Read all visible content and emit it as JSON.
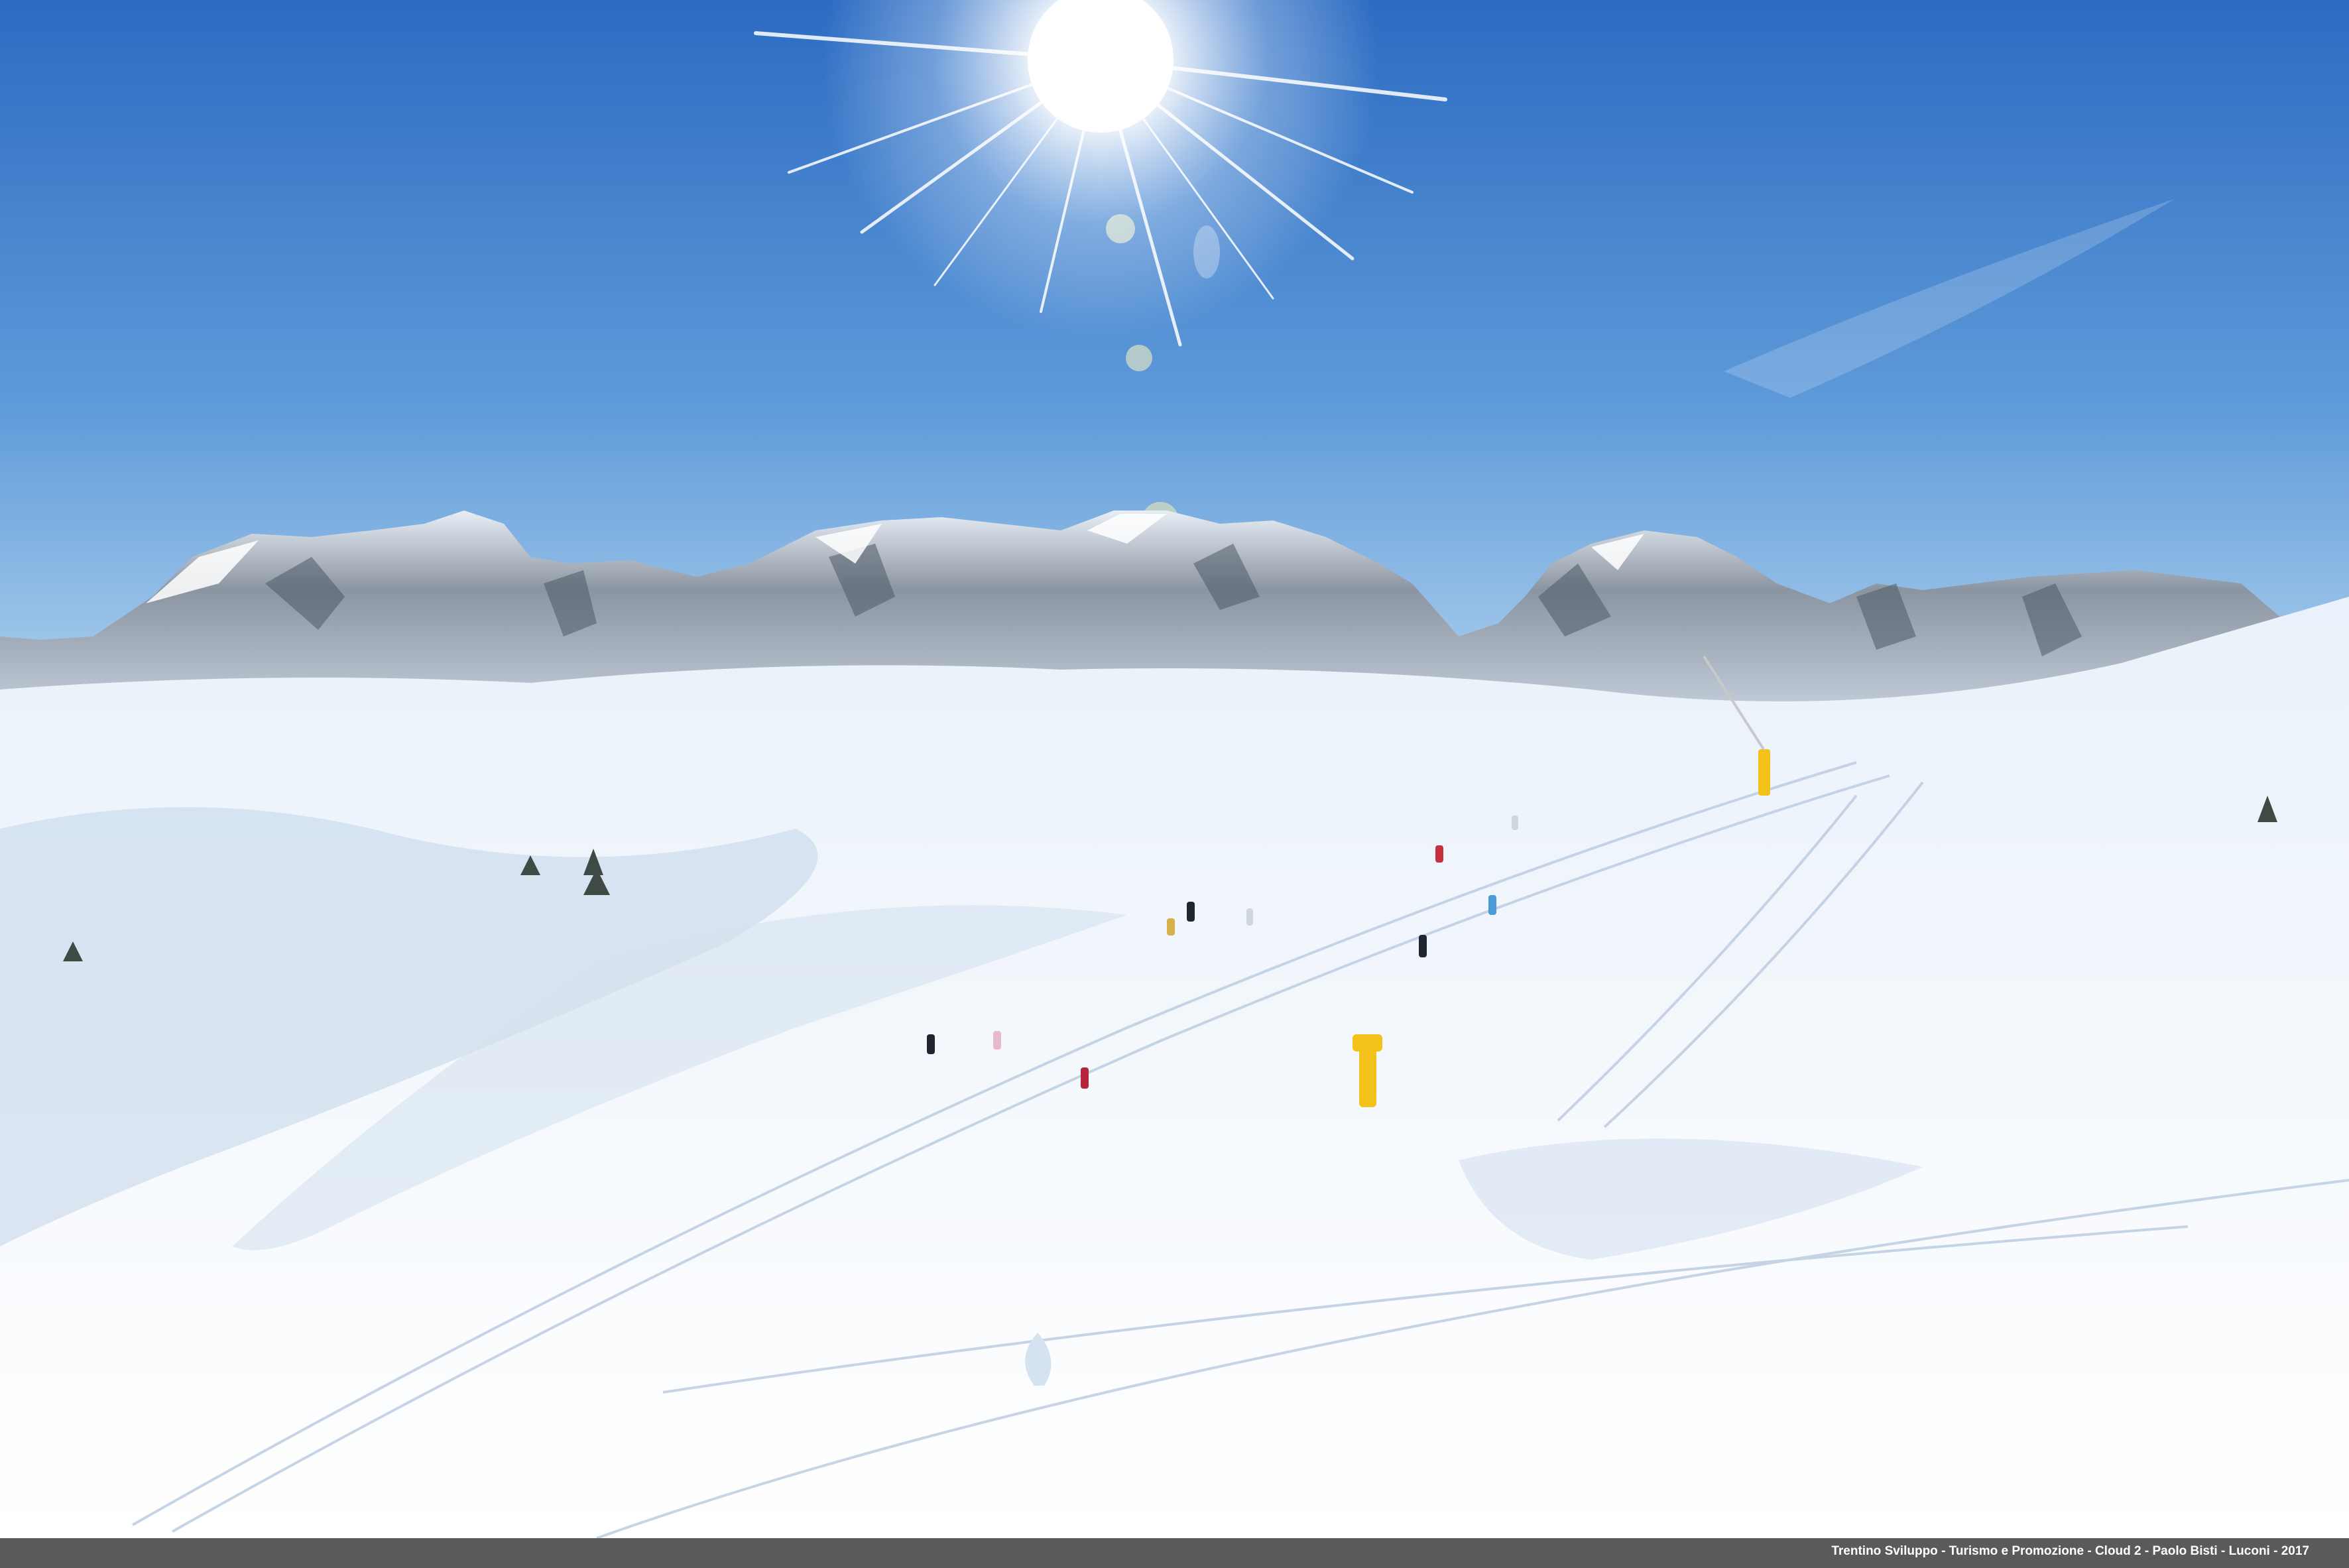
{
  "photo": {
    "subject": "ski-slope-with-dolomite-mountains",
    "credit": "Trentino Sviluppo - Turismo e Promozione - Cloud 2 - Paolo Bisti - Luconi - 2017",
    "colors": {
      "sky_top": "#2f6fc4",
      "sky_horizon": "#a9cfee",
      "snow": "#fbfdff",
      "snow_shadow": "#c9d8ea",
      "rock": "#6f7a86",
      "snow_cannon": "#f2c21b"
    }
  }
}
